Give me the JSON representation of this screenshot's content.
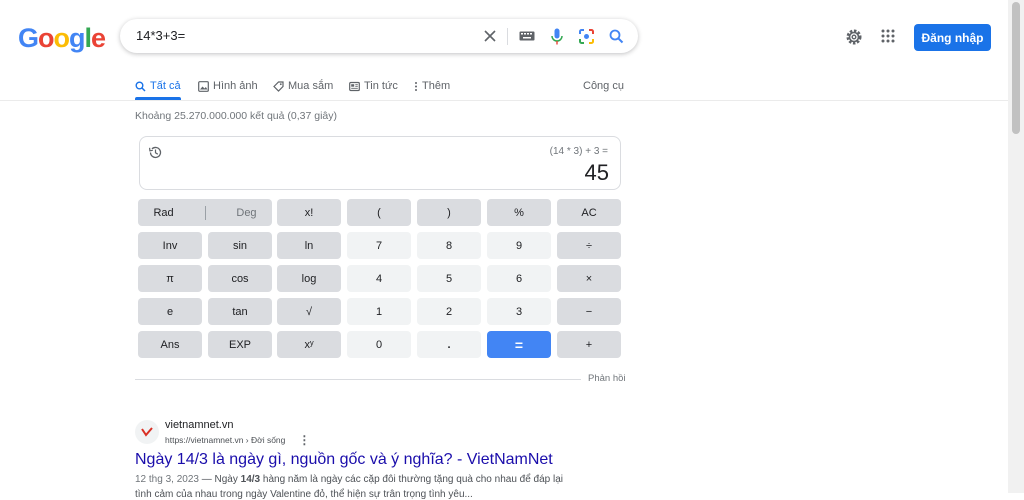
{
  "logo": {
    "letters": [
      "G",
      "o",
      "o",
      "g",
      "l",
      "e"
    ],
    "colors": [
      "#4285f4",
      "#ea4335",
      "#fbbc05",
      "#4285f4",
      "#34a853",
      "#ea4335"
    ]
  },
  "search": {
    "query": "14*3+3="
  },
  "icons": {
    "clear": "close-icon",
    "keyboard": "keyboard-icon",
    "mic": "mic-icon",
    "lens": "camera-icon",
    "search": "search-icon"
  },
  "header": {
    "signin_label": "Đăng nhập",
    "brand_color": "#1a73e8"
  },
  "tabs": [
    {
      "label": "Tất cả",
      "icon": "search-icon",
      "active": true
    },
    {
      "label": "Hình ảnh",
      "icon": "image-icon",
      "active": false
    },
    {
      "label": "Mua sắm",
      "icon": "tag-icon",
      "active": false
    },
    {
      "label": "Tin tức",
      "icon": "news-icon",
      "active": false
    },
    {
      "label": "Thêm",
      "icon": "more-vert-icon",
      "active": false
    }
  ],
  "tools_label": "Công cụ",
  "stats": "Khoảng 25.270.000.000 kết quả (0,37 giây)",
  "calculator": {
    "expression": "(14 * 3) + 3 =",
    "result": "45",
    "keys": [
      [
        "Rad|Deg",
        "x!",
        "(",
        ")",
        "%",
        "AC"
      ],
      [
        "Inv",
        "sin",
        "ln",
        "7",
        "8",
        "9",
        "÷"
      ],
      [
        "π",
        "cos",
        "log",
        "4",
        "5",
        "6",
        "×"
      ],
      [
        "e",
        "tan",
        "√",
        "1",
        "2",
        "3",
        "−"
      ],
      [
        "Ans",
        "EXP",
        "xʸ",
        "0",
        ".",
        "=",
        "+"
      ]
    ],
    "rad_label": "Rad",
    "deg_label": "Deg"
  },
  "feedback_label": "Phản hồi",
  "result": {
    "site_name": "vietnamnet.vn",
    "url": "https://vietnamnet.vn › Đời sống",
    "title": "Ngày 14/3 là ngày gì, nguồn gốc và ý nghĩa? - VietNamNet",
    "snippet_date": "12 thg 3, 2023",
    "snippet_dash": " — Ngày ",
    "snippet_bold": "14/3",
    "snippet_rest": " hàng năm là ngày các cặp đôi thường tặng quà cho nhau để đáp lại",
    "snippet_line2": "tình cảm của nhau trong ngày Valentine đỏ, thể hiện sự trân trọng tình yêu..."
  }
}
